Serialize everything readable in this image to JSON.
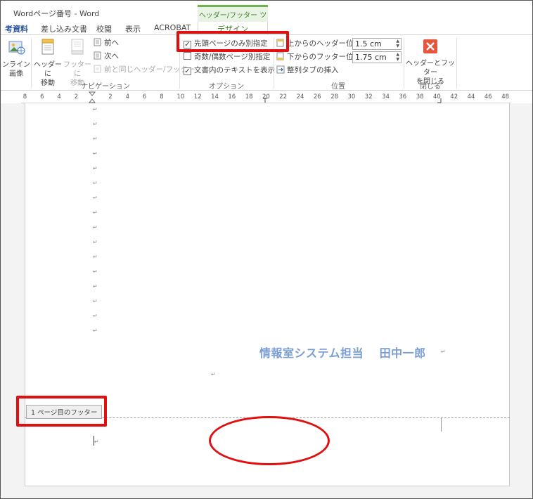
{
  "window": {
    "app_title": "Wordページ番号 - Word",
    "context_tab_group": "ヘッダー/フッター ツール"
  },
  "tabs": [
    {
      "label": "考資料"
    },
    {
      "label": "差し込み文書"
    },
    {
      "label": "校閲"
    },
    {
      "label": "表示"
    },
    {
      "label": "ACROBAT"
    },
    {
      "label": "デザイン"
    }
  ],
  "ribbon": {
    "navigation": {
      "inline_image_label": "ンライン\n画像",
      "goto_header_label": "ヘッダーに\n移動",
      "goto_footer_label": "フッターに\n移動",
      "prev_label": "前へ",
      "next_label": "次へ",
      "link_prev_label": "前と同じヘッダー/フッター",
      "group_label": "ナビゲーション"
    },
    "options": {
      "different_first_page": {
        "label": "先頭ページのみ別指定",
        "checked": true
      },
      "different_odd_even": {
        "label": "奇数/偶数ページ別指定",
        "checked": false
      },
      "show_document_text": {
        "label": "文書内のテキストを表示",
        "checked": true
      },
      "group_label": "オプション"
    },
    "position": {
      "header_from_top_label": "上からのヘッダー位置:",
      "header_from_top_value": "1.5 cm",
      "footer_from_bottom_label": "下からのフッター位置:",
      "footer_from_bottom_value": "1.75 cm",
      "insert_align_tab_label": "整列タブの挿入",
      "group_label": "位置"
    },
    "close": {
      "close_button_label": "ヘッダーとフッター\nを閉じる",
      "group_label": "閉じる"
    }
  },
  "ruler": {
    "left_numbers": [
      "8",
      "6",
      "4",
      "2"
    ],
    "right_numbers": [
      "2",
      "4",
      "6",
      "8",
      "10",
      "12",
      "14",
      "16",
      "18",
      "20",
      "22",
      "24",
      "26",
      "28",
      "30",
      "32",
      "34",
      "36",
      "38",
      "40",
      "42",
      "44",
      "46",
      "48"
    ]
  },
  "document": {
    "paragraph_mark": "↵",
    "body_text": "情報室システム担当　 田中一郎",
    "footer_tab_label": "1 ページ目のフッター"
  },
  "colors": {
    "annotation_red": "#e01010",
    "context_green": "#70b24f",
    "body_text_blue": "#7a9ed4",
    "word_blue": "#2b579a"
  }
}
